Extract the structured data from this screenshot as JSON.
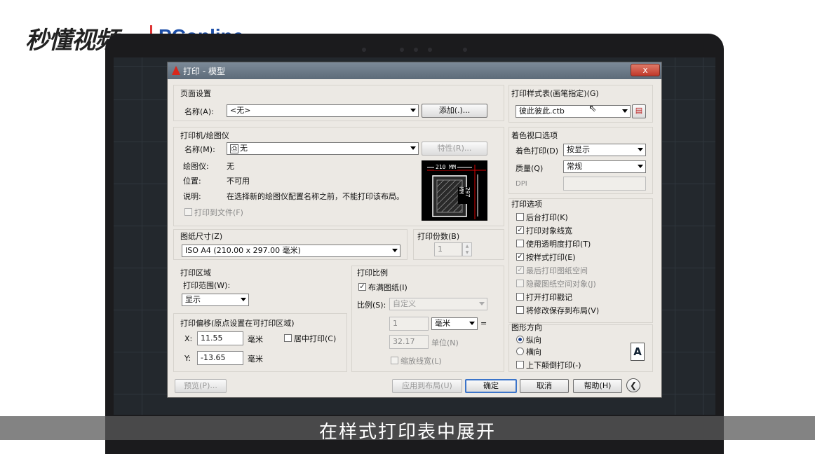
{
  "watermark": {
    "left_text": "秒懂视频",
    "right_text": "PConline"
  },
  "dialog": {
    "title": "打印 - 模型",
    "close_label": "x",
    "page_setup": {
      "group_label": "页面设置",
      "name_label": "名称(A):",
      "name_value": "<无>",
      "add_button": "添加(.)..."
    },
    "printer": {
      "group_label": "打印机/绘图仪",
      "name_label": "名称(M):",
      "name_value": "无",
      "properties_button": "特性(R)...",
      "plotter_label": "绘图仪:",
      "plotter_value": "无",
      "location_label": "位置:",
      "location_value": "不可用",
      "description_label": "说明:",
      "description_value": "在选择新的绘图仪配置名称之前，不能打印该布局。",
      "print_to_file": "打印到文件(F)",
      "preview_width": "210 MM",
      "preview_height": "297 MM"
    },
    "paper_size": {
      "group_label": "图纸尺寸(Z)",
      "value": "ISO A4 (210.00 x 297.00 毫米)"
    },
    "copies": {
      "group_label": "打印份数(B)",
      "value": "1"
    },
    "plot_area": {
      "group_label": "打印区域",
      "range_label": "打印范围(W):",
      "range_value": "显示"
    },
    "offset": {
      "group_label": "打印偏移(原点设置在可打印区域)",
      "x_label": "X:",
      "x_value": "11.55",
      "x_unit": "毫米",
      "y_label": "Y:",
      "y_value": "-13.65",
      "y_unit": "毫米",
      "center_label": "居中打印(C)"
    },
    "scale": {
      "group_label": "打印比例",
      "fit_label": "布满图纸(I)",
      "scale_label": "比例(S):",
      "scale_value": "自定义",
      "value1": "1",
      "unit_value": "毫米",
      "equals": "=",
      "value2": "32.17",
      "unit_label": "单位(N)",
      "lineweights_label": "缩放线宽(L)"
    },
    "style_table": {
      "group_label": "打印样式表(画笔指定)(G)",
      "value": "彼此彼此.ctb"
    },
    "shaded": {
      "group_label": "着色视口选项",
      "shade_label": "着色打印(D)",
      "shade_value": "按显示",
      "quality_label": "质量(Q)",
      "quality_value": "常规",
      "dpi_label": "DPI"
    },
    "options": {
      "group_label": "打印选项",
      "items": [
        {
          "label": "后台打印(K)",
          "checked": ""
        },
        {
          "label": "打印对象线宽",
          "checked": "✓"
        },
        {
          "label": "使用透明度打印(T)",
          "checked": ""
        },
        {
          "label": "按样式打印(E)",
          "checked": "✓"
        },
        {
          "label": "最后打印图纸空间",
          "checked": "✓"
        },
        {
          "label": "隐藏图纸空间对象(J)",
          "checked": ""
        },
        {
          "label": "打开打印戳记",
          "checked": ""
        },
        {
          "label": "将修改保存到布局(V)",
          "checked": ""
        }
      ]
    },
    "orientation": {
      "group_label": "图形方向",
      "portrait": "纵向",
      "landscape": "横向",
      "upside_down": "上下颠倒打印(-)",
      "icon_letter": "A"
    },
    "footer": {
      "preview": "预览(P)...",
      "apply": "应用到布局(U)",
      "ok": "确定",
      "cancel": "取消",
      "help": "帮助(H)"
    }
  },
  "subtitle": "在样式打印表中展开"
}
